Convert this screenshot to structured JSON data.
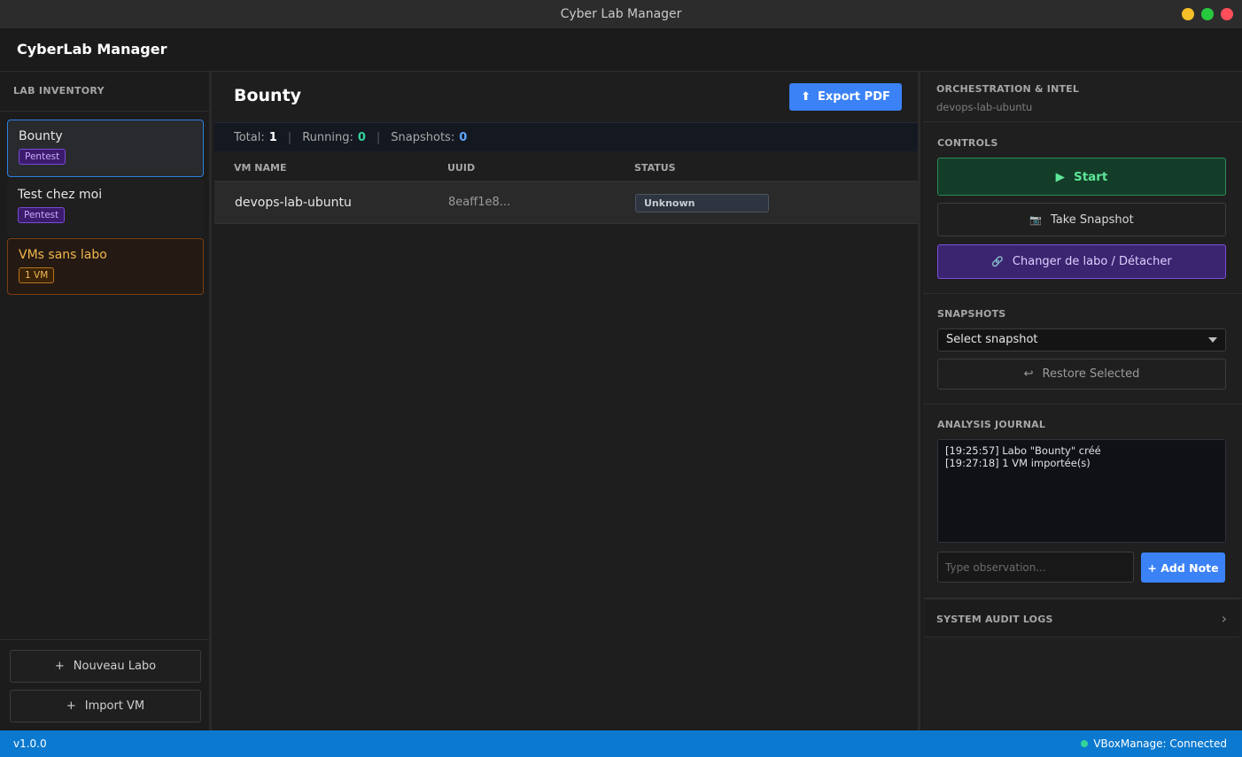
{
  "window": {
    "title": "Cyber Lab Manager"
  },
  "app": {
    "brand": "CyberLab Manager"
  },
  "sidebar": {
    "heading": "LAB INVENTORY",
    "labs": [
      {
        "name": "Bounty",
        "badge": "Pentest",
        "active": true
      },
      {
        "name": "Test chez moi",
        "badge": "Pentest",
        "active": false
      },
      {
        "name": "VMs sans labo",
        "badge": "1 VM",
        "active": false
      }
    ],
    "buttons": {
      "new_lab": "Nouveau Labo",
      "import_vm": "Import VM",
      "plus_icon": "+"
    }
  },
  "main": {
    "title": "Bounty",
    "export_label": "Export PDF",
    "export_icon": "⬆",
    "stats": {
      "total_label": "Total:",
      "total": "1",
      "running_label": "Running:",
      "running": "0",
      "snapshots_label": "Snapshots:",
      "snapshots": "0",
      "separator": "|"
    },
    "table": {
      "columns": [
        "VM NAME",
        "UUID",
        "STATUS"
      ],
      "rows": [
        {
          "name": "devops-lab-ubuntu",
          "uuid": "8eaff1e8...",
          "status": "Unknown"
        }
      ]
    }
  },
  "panel": {
    "heading": "ORCHESTRATION & INTEL",
    "selected_vm": "devops-lab-ubuntu",
    "controls": {
      "heading": "CONTROLS",
      "start": "Start",
      "start_icon": "▶",
      "snapshot": "Take Snapshot",
      "snapshot_icon": "📷",
      "change_lab": "Changer de labo / Détacher",
      "link_icon": "🔗"
    },
    "snapshots": {
      "heading": "SNAPSHOTS",
      "selected": "Select snapshot",
      "restore": "Restore Selected",
      "restore_icon": "↩"
    },
    "journal": {
      "heading": "ANALYSIS JOURNAL",
      "entries": [
        "[19:25:57] Labo \"Bounty\" créé",
        "[19:27:18] 1 VM importée(s)"
      ],
      "input_placeholder": "Type observation...",
      "add_note": "+ Add Note"
    },
    "audit": {
      "heading": "SYSTEM AUDIT LOGS",
      "chevron": "›"
    }
  },
  "statusbar": {
    "version": "v1.0.0",
    "connection": "VBoxManage: Connected"
  },
  "colors": {
    "accent": "#3b82f6",
    "statusbar": "#0b79cf",
    "running": "#34d399",
    "snapshots": "#60a5fa"
  }
}
